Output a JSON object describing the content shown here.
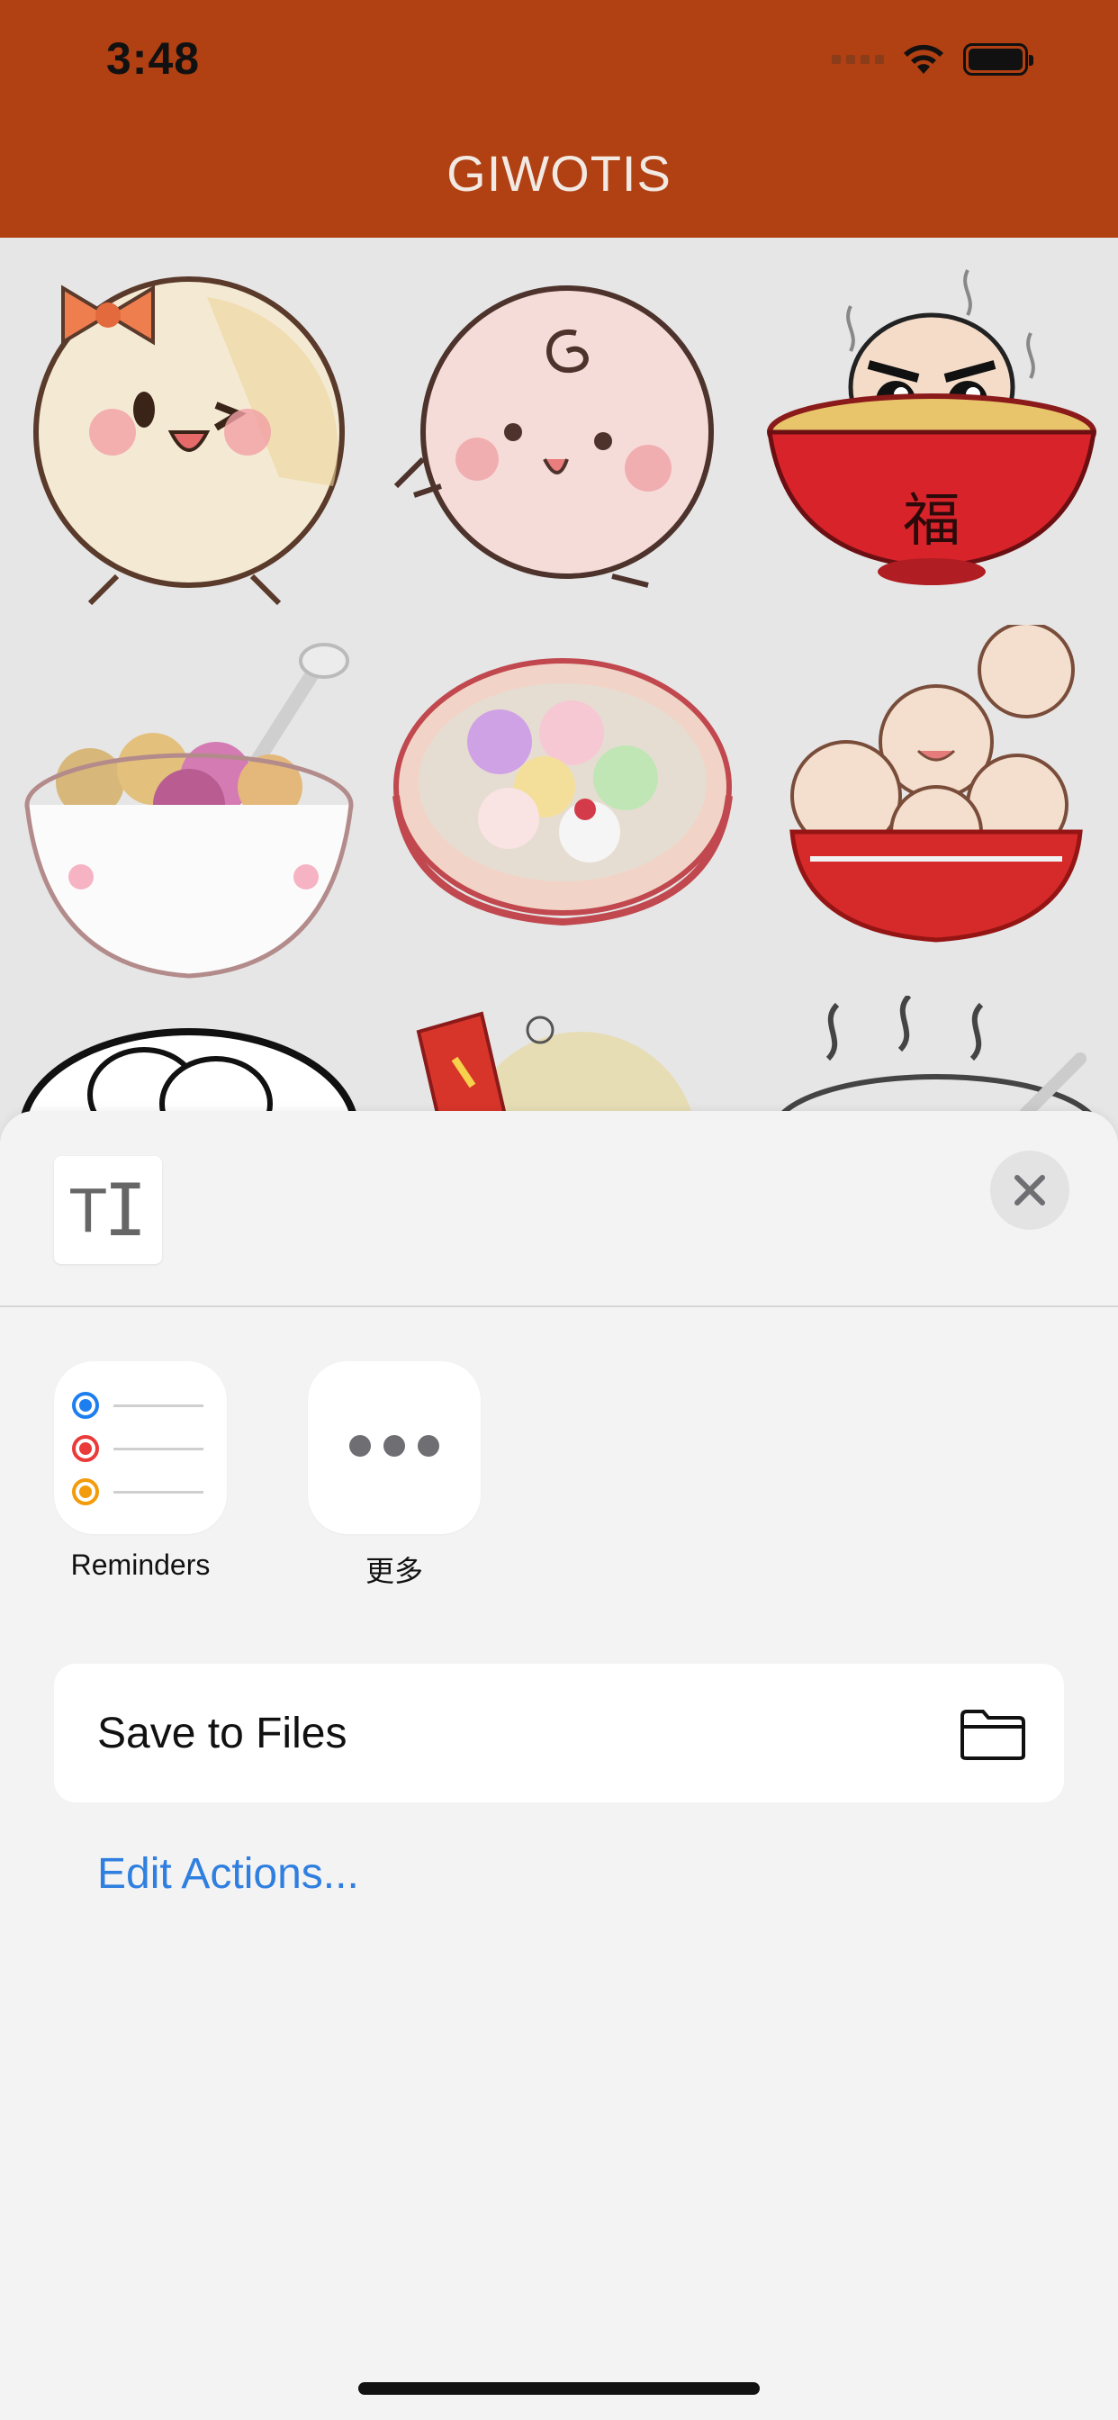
{
  "status_bar": {
    "time": "3:48"
  },
  "header": {
    "title": "GIWOTIS",
    "background": "#b14012"
  },
  "stickers": [
    {
      "icon": "cream-tangyuan-with-bow-sticker"
    },
    {
      "icon": "pink-tangyuan-running-sticker"
    },
    {
      "icon": "tangyuan-in-red-fu-bowl-sticker"
    },
    {
      "icon": "tangyuan-bowl-with-spoon-sticker"
    },
    {
      "icon": "colorful-tangyuan-soup-bowl-sticker"
    },
    {
      "icon": "smiling-tangyuan-in-red-bowl-sticker"
    },
    {
      "icon": "tangyuan-bowl-outline-sticker"
    },
    {
      "icon": "festive-tangyuan-sticker"
    },
    {
      "icon": "steaming-bowl-sticker"
    }
  ],
  "share_sheet": {
    "preview_icon": "text-document-icon",
    "close_icon": "close-icon",
    "apps": [
      {
        "label": "Reminders",
        "icon": "reminders-app-icon"
      },
      {
        "label": "更多",
        "icon": "more-apps-icon"
      }
    ],
    "actions": [
      {
        "label": "Save to Files",
        "icon": "folder-icon"
      }
    ],
    "edit_actions_label": "Edit Actions...",
    "accent_color": "#2f7fe0"
  }
}
